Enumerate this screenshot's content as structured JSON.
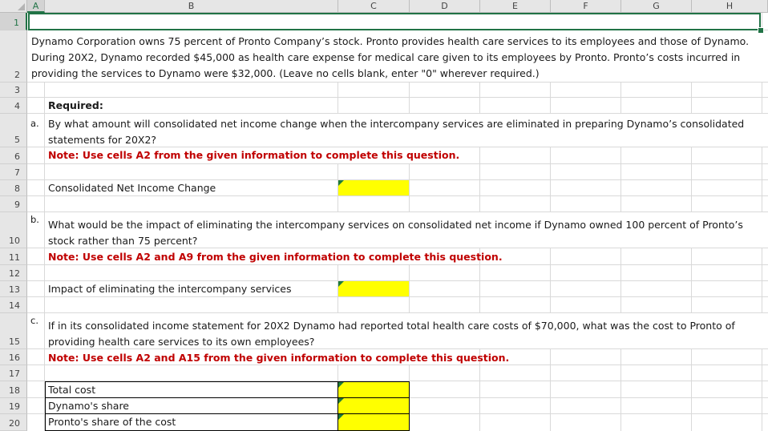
{
  "columns": [
    "A",
    "B",
    "C",
    "D",
    "E",
    "F",
    "G",
    "H"
  ],
  "rows": [
    "1",
    "2",
    "3",
    "4",
    "5",
    "6",
    "7",
    "8",
    "9",
    "10",
    "11",
    "12",
    "13",
    "14",
    "15",
    "16",
    "17",
    "18",
    "19",
    "20"
  ],
  "selected_cell": "A1",
  "intro": "Dynamo Corporation owns 75 percent of Pronto Company’s stock. Pronto provides health care services to its employees and those of Dynamo. During 20X2, Dynamo recorded $45,000 as health care expense for medical care given to its employees by Pronto. Pronto’s costs incurred in providing the services to Dynamo were $32,000. (Leave no cells blank, enter \"0\" wherever required.)",
  "required_label": "Required:",
  "part_a": {
    "letter": "a.",
    "question": "By what amount will consolidated net income change when the intercompany services are eliminated in preparing Dynamo’s consolidated statements for 20X2?",
    "note": "Note: Use cells A2 from the given information to complete this question.",
    "label": "Consolidated Net Income Change",
    "value": ""
  },
  "part_b": {
    "letter": "b.",
    "question": "What would be the impact of eliminating the intercompany services on consolidated net income if Dynamo owned 100 percent of Pronto’s stock rather than 75 percent?",
    "note": "Note: Use cells A2 and A9 from the given information to complete this question.",
    "label": "Impact of eliminating the intercompany services",
    "value": ""
  },
  "part_c": {
    "letter": "c.",
    "question": "If in its consolidated income statement for 20X2 Dynamo had reported total health care costs of $70,000, what was the cost to Pronto of providing health care services to its own employees?",
    "note": "Note: Use cells A2 and A15 from the given information to complete this question.",
    "rows": [
      {
        "label": "Total cost",
        "value": ""
      },
      {
        "label": "Dynamo's share",
        "value": ""
      },
      {
        "label": "Pronto's share of the cost",
        "value": ""
      }
    ]
  },
  "colors": {
    "input_fill": "#FFFF00",
    "note_text": "#C00000",
    "selection": "#217346",
    "flag": "#1E7A3C"
  }
}
